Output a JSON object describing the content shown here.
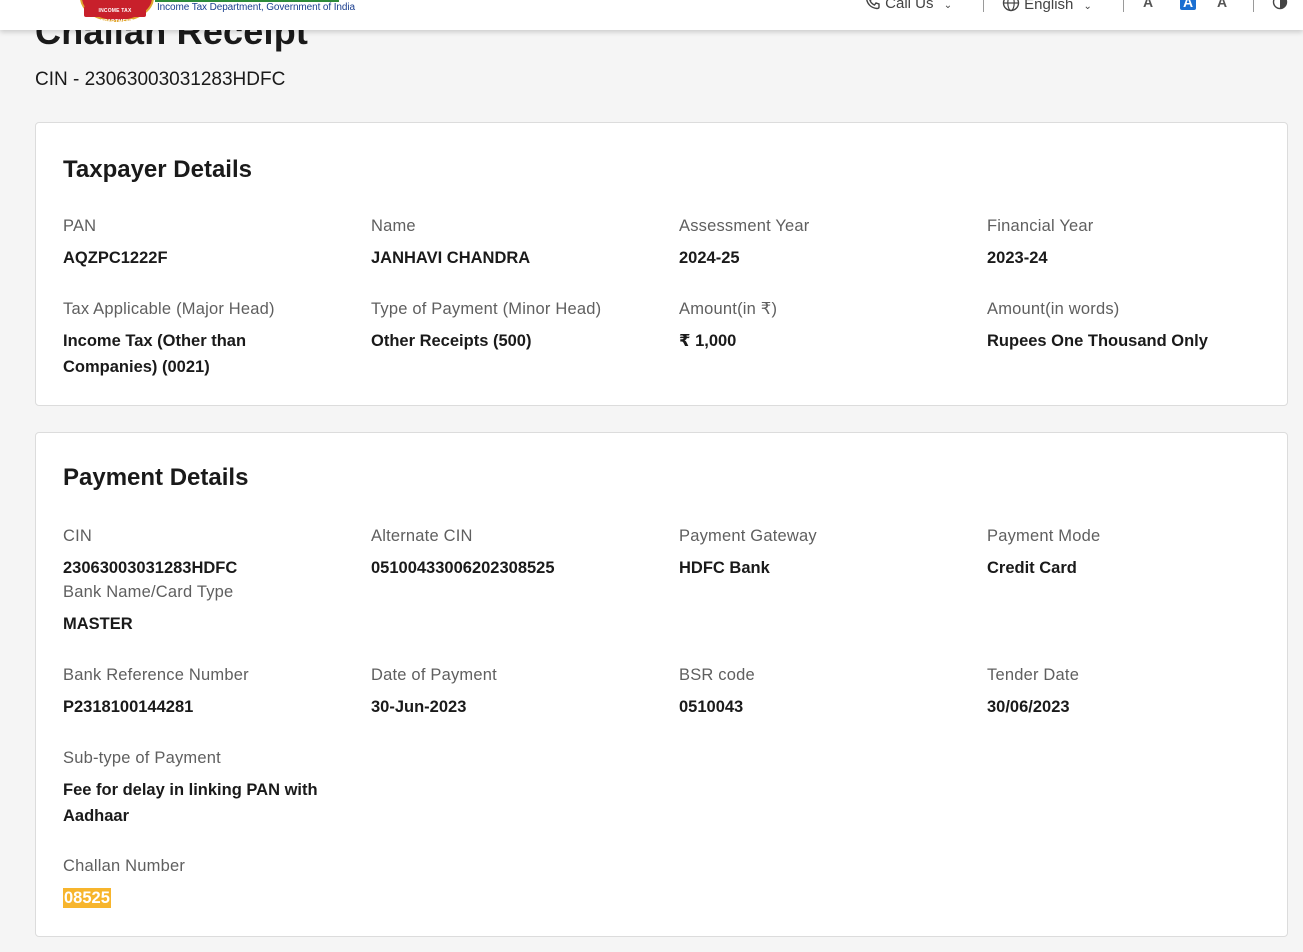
{
  "header": {
    "department_text": "Income Tax Department, Government of India",
    "logo_text": "INCOME TAX DEPARTMENT",
    "call_us": "Call Us",
    "language": "English",
    "font_small": "A",
    "font_normal": "A",
    "font_large": "A",
    "icons": [
      "menu-icon",
      "phone-icon",
      "chevron-down-icon",
      "globe-icon",
      "contrast-icon"
    ]
  },
  "page": {
    "title": "Challan Receipt",
    "cin_line": "CIN - 23063003031283HDFC"
  },
  "taxpayer": {
    "title": "Taxpayer Details",
    "fields": [
      {
        "label": "PAN",
        "value": "AQZPC1222F"
      },
      {
        "label": "Name",
        "value": "JANHAVI CHANDRA"
      },
      {
        "label": "Assessment Year",
        "value": "2024-25"
      },
      {
        "label": "Financial Year",
        "value": "2023-24"
      },
      {
        "label": "Tax Applicable (Major Head)",
        "value": "Income Tax (Other than Companies) (0021)"
      },
      {
        "label": "Type of Payment (Minor Head)",
        "value": "Other Receipts (500)"
      },
      {
        "label": "Amount(in ₹)",
        "value": "₹ 1,000"
      },
      {
        "label": "Amount(in words)",
        "value": "Rupees One Thousand Only"
      }
    ]
  },
  "payment": {
    "title": "Payment Details",
    "fields": [
      {
        "label": "CIN",
        "value": "23063003031283HDFC"
      },
      {
        "label": "Alternate CIN",
        "value": "05100433006202308525"
      },
      {
        "label": "Payment Gateway",
        "value": "HDFC Bank"
      },
      {
        "label": "Payment Mode",
        "value": "Credit Card"
      },
      {
        "label": "Bank Name/Card Type",
        "value": "MASTER"
      },
      {
        "label": "Bank Reference Number",
        "value": "P2318100144281"
      },
      {
        "label": "Date of Payment",
        "value": "30-Jun-2023"
      },
      {
        "label": "BSR code",
        "value": "0510043"
      },
      {
        "label": "Tender Date",
        "value": "30/06/2023"
      },
      {
        "label": "Sub-type of Payment",
        "value": "Fee for delay in linking PAN with Aadhaar"
      },
      {
        "label": "Challan Number",
        "value": "08525"
      }
    ]
  },
  "colors": {
    "highlight": "#f7b52d",
    "brand_blue": "#1b3f8f",
    "accent_blue": "#1b6fd1",
    "emblem_red": "#c8202b"
  }
}
